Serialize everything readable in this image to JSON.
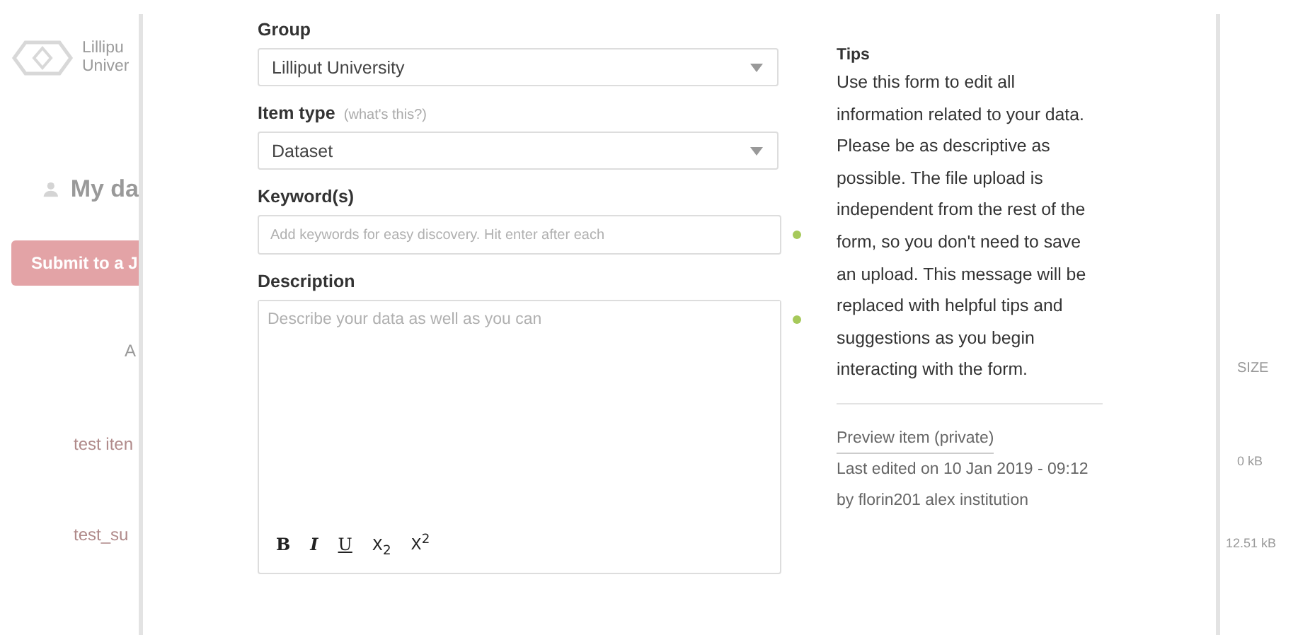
{
  "background": {
    "logo_lines": [
      "Lillipu",
      "Univer"
    ],
    "heading": "My da",
    "submit_button": "Submit to a J",
    "column_header": "A",
    "rows": [
      "test iten",
      "test_su"
    ],
    "size_header": "SIZE",
    "sizes": [
      "0 kB",
      "12.51 kB"
    ]
  },
  "form": {
    "fields": [
      {
        "kind": "select",
        "label": "Group",
        "value": "Lilliput University",
        "indicator": false
      },
      {
        "kind": "select",
        "label": "Item type",
        "hint": "(what's this?)",
        "value": "Dataset",
        "indicator": false
      },
      {
        "kind": "text",
        "label": "Keyword(s)",
        "placeholder": "Add keywords for easy discovery. Hit enter after each",
        "indicator": true
      },
      {
        "kind": "textarea",
        "label": "Description",
        "placeholder": "Describe your data as well as you can",
        "indicator": true
      }
    ],
    "toolbar": [
      {
        "kind": "bold",
        "label": "B"
      },
      {
        "kind": "italic",
        "label": "I"
      },
      {
        "kind": "underline",
        "label": "U"
      },
      {
        "kind": "subscript",
        "label": "X$_{2}$"
      },
      {
        "kind": "superscript",
        "label": "X$^{2}$"
      }
    ]
  },
  "tips": {
    "title": "Tips",
    "text": "Use this form to edit all information related to your data. Please be as descriptive as possible. The file upload is independent from the rest of the form, so you don't need to save an upload. This message will be replaced with helpful tips and suggestions as you begin interacting with the form.",
    "link": "Preview item (private)",
    "last_edited": "Last edited on 10 Jan 2019 - 09:12 by florin201 alex institution"
  }
}
